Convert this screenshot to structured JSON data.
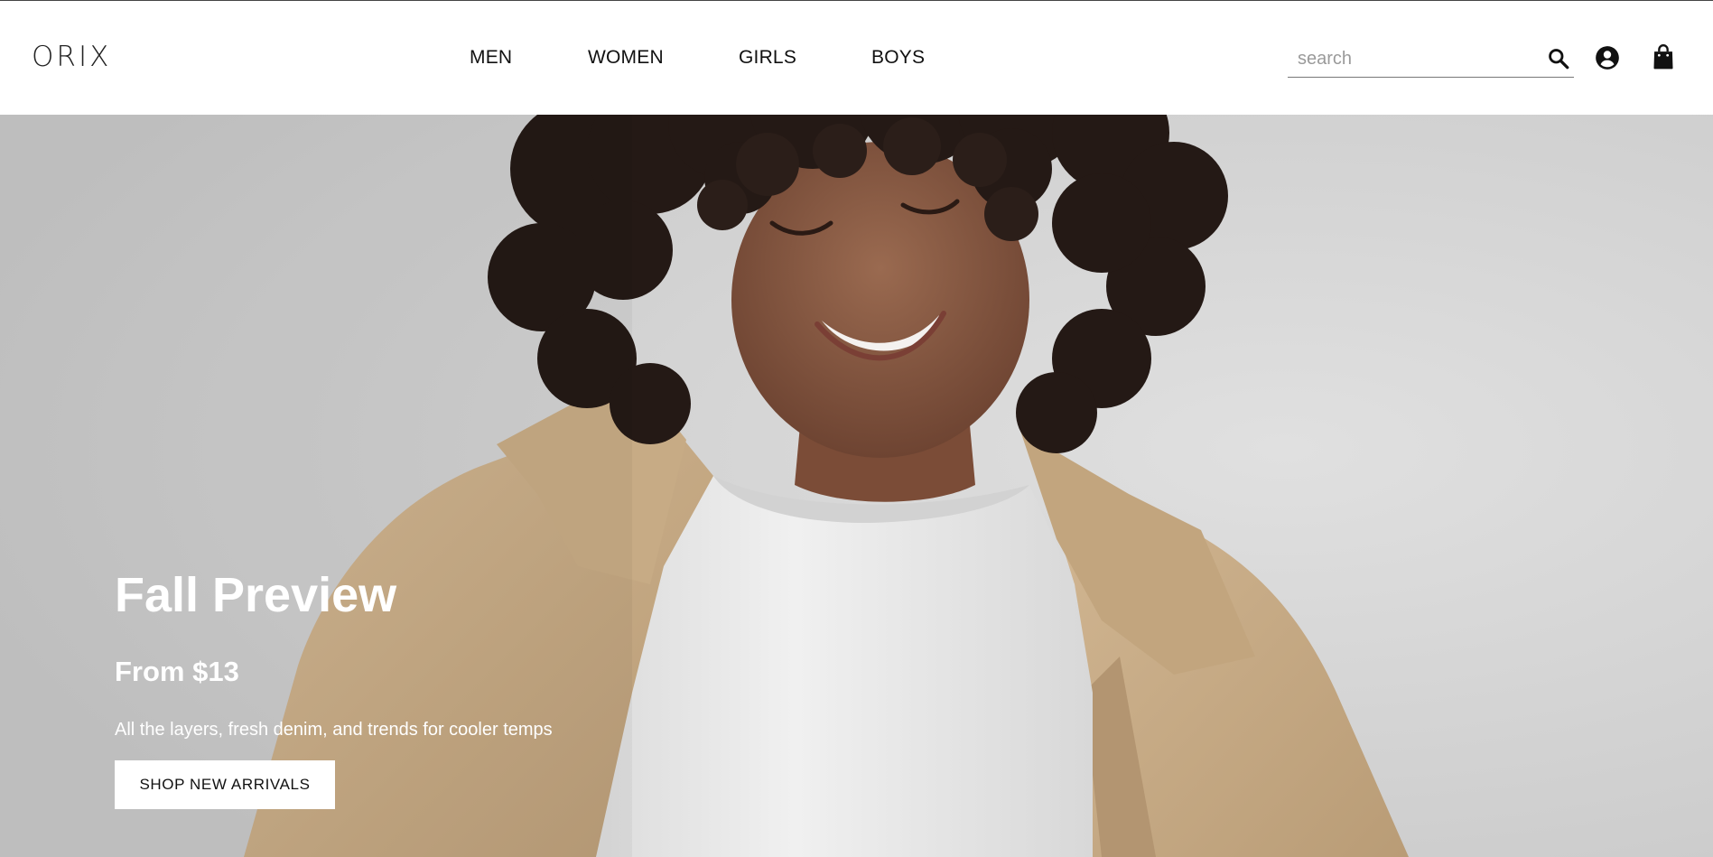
{
  "brand": {
    "logo_text": "ORIX"
  },
  "nav": {
    "items": [
      {
        "label": "MEN"
      },
      {
        "label": "WOMEN"
      },
      {
        "label": "GIRLS"
      },
      {
        "label": "BOYS"
      }
    ]
  },
  "search": {
    "placeholder": "search",
    "value": "",
    "icon": "search-icon"
  },
  "header_icons": {
    "account": "account-circle-icon",
    "cart": "shopping-bag-icon"
  },
  "hero": {
    "title": "Fall Preview",
    "price": "From $13",
    "description": "All the layers, fresh denim, and trends for cooler temps",
    "cta_label": "SHOP NEW ARRIVALS",
    "colors": {
      "background": "#cfcfcf",
      "jacket": "#c9ae8a",
      "tshirt": "#ececec",
      "hair": "#2a1f1b",
      "skin": "#8a5a42",
      "text": "#ffffff"
    }
  }
}
